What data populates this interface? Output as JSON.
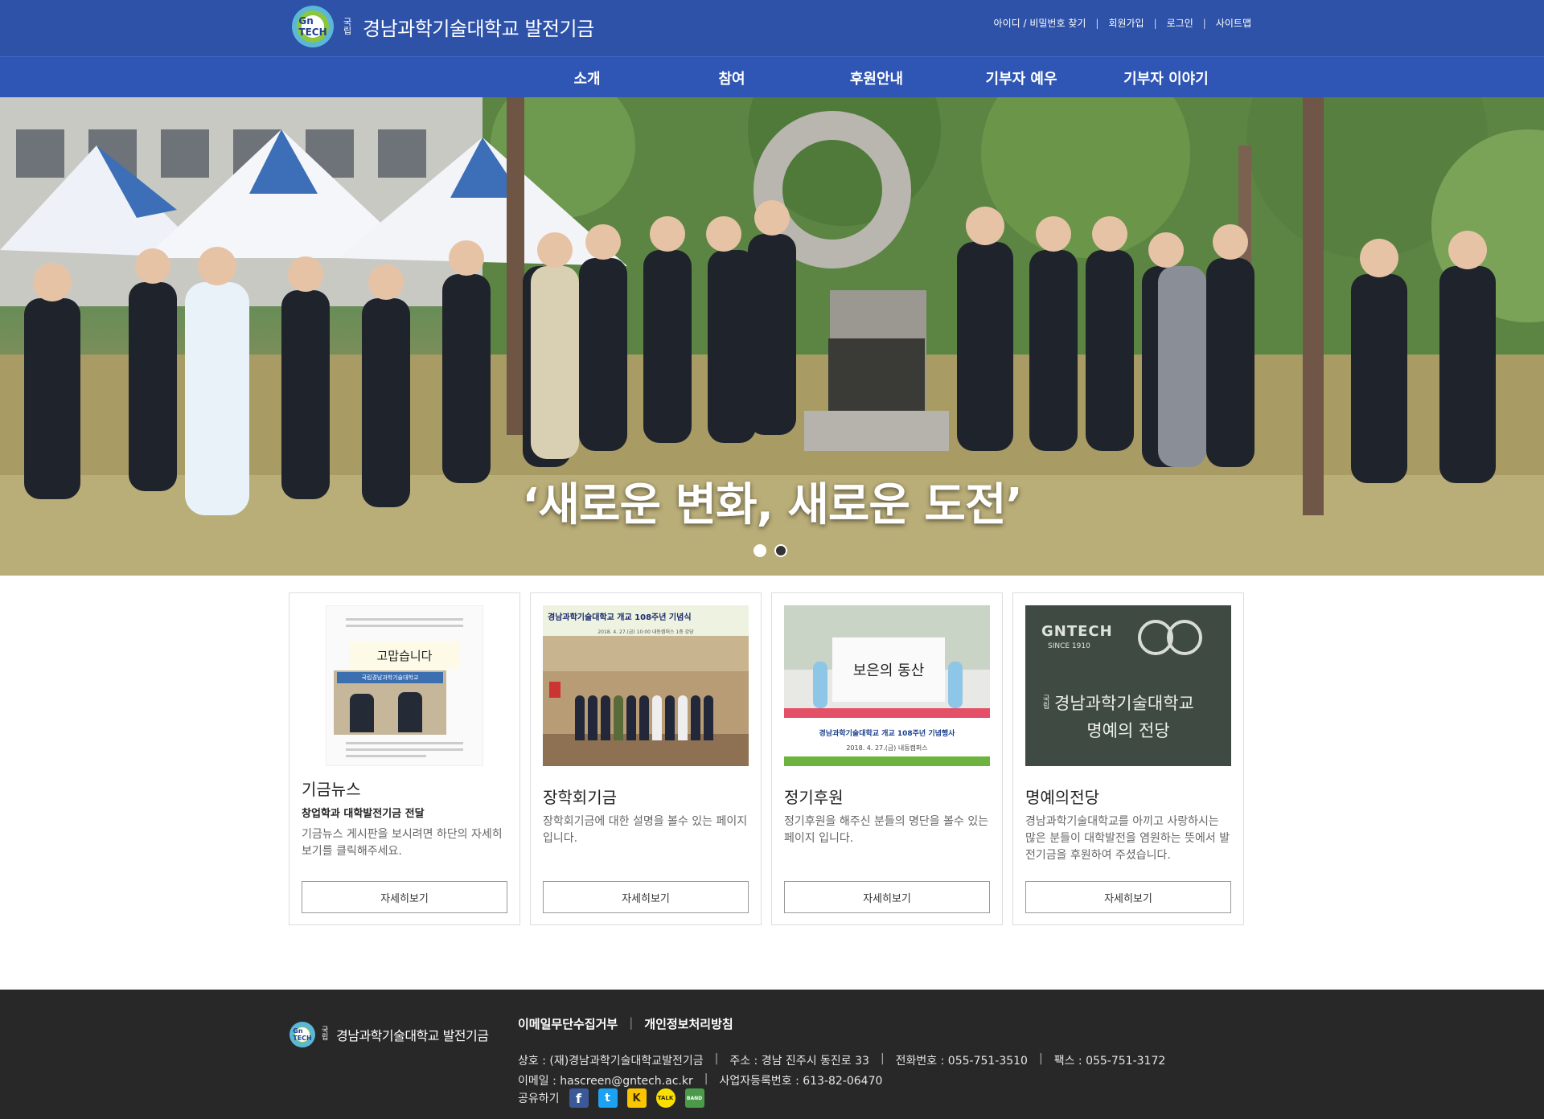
{
  "header": {
    "logo_mark": "Gn TECH",
    "logo_small": "국립",
    "site_title": "경남과학기술대학교 발전기금",
    "util_links": [
      "아이디 / 비밀번호 찾기",
      "회원가입",
      "로그인",
      "사이트맵"
    ]
  },
  "nav": [
    "소개",
    "참여",
    "후원안내",
    "기부자 예우",
    "기부자 이야기"
  ],
  "hero": {
    "caption": "‘새로운 변화, 새로운 도전’",
    "slides": 2,
    "active_slide": 1
  },
  "cards": [
    {
      "title": "기금뉴스",
      "subtitle": "창업학과 대학발전기금 전달",
      "description": "기금뉴스 게시판을 보시려면 하단의 자세히보기를 클릭해주세요.",
      "button": "자세히보기",
      "image_text": [
        "고맙습니다",
        "국립경남과학기술대학교"
      ]
    },
    {
      "title": "장학회기금",
      "subtitle": "",
      "description": "장학회기금에 대한 설명을 볼수 있는 페이지 입니다.",
      "button": "자세히보기",
      "image_text": [
        "경남과학기술대학교 개교 108주년 기념식",
        "2018. 4. 27.(금) 10:00   내동캠퍼스 1층 강당"
      ]
    },
    {
      "title": "정기후원",
      "subtitle": "",
      "description": "정기후원을 해주신 분들의 명단을 볼수 있는 페이지 입니다.",
      "button": "자세히보기",
      "image_text": [
        "보은의 동산",
        "경남과학기술대학교 개교 108주년 기념행사",
        "2018. 4. 27.(금)   내동캠퍼스"
      ]
    },
    {
      "title": "명예의전당",
      "subtitle": "",
      "description": "경남과학기술대학교를 아끼고 사랑하시는 많은 분들이 대학발전을 염원하는 뜻에서 발전기금을 후원하여 주셨습니다.",
      "button": "자세히보기",
      "image_text": [
        "GNTECH",
        "SINCE 1910",
        "국립",
        "경남과학기술대학교",
        "명예의 전당"
      ]
    }
  ],
  "footer": {
    "site_title": "경남과학기술대학교 발전기금",
    "logo_small": "국립",
    "links": [
      "이메일무단수집거부",
      "개인정보처리방침"
    ],
    "company": "상호 : (재)경남과학기술대학교발전기금",
    "address": "주소 : 경남 진주시 동진로 33",
    "phone": "전화번호 : 055-751-3510",
    "fax": "팩스 : 055-751-3172",
    "email": "이메일 : hascreen@gntech.ac.kr",
    "biz_no": "사업자등록번호 : 613-82-06470",
    "share_label": "공유하기",
    "sns": [
      {
        "name": "facebook-icon",
        "glyph": "f",
        "color": "#3b5998"
      },
      {
        "name": "twitter-icon",
        "glyph": "t",
        "color": "#1da1f2"
      },
      {
        "name": "kakaostory-icon",
        "glyph": "K",
        "color": "#f9c500"
      },
      {
        "name": "kakaotalk-icon",
        "glyph": "TALK",
        "color": "#f9e000"
      },
      {
        "name": "band-icon",
        "glyph": "BAND",
        "color": "#4a9a4a"
      }
    ]
  }
}
